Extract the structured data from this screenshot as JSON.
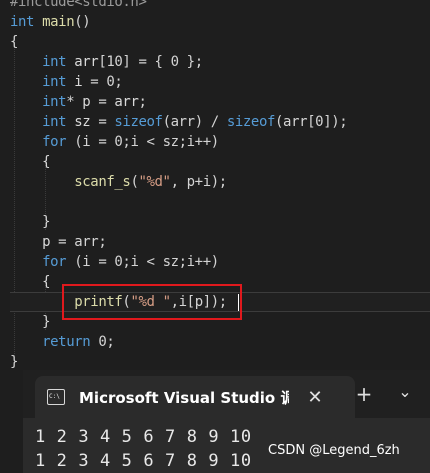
{
  "editor": {
    "lines": [
      [
        {
          "t": "#include<stdio.h>",
          "c": "pp"
        }
      ],
      [
        {
          "t": "int",
          "c": "kw"
        },
        {
          "t": " ",
          "c": ""
        },
        {
          "t": "main",
          "c": "fn"
        },
        {
          "t": "()",
          "c": ""
        }
      ],
      [
        {
          "t": "{",
          "c": ""
        }
      ],
      [
        {
          "t": "    ",
          "c": ""
        },
        {
          "t": "int",
          "c": "kw"
        },
        {
          "t": " ",
          "c": ""
        },
        {
          "t": "arr",
          "c": "id"
        },
        {
          "t": "[10] = { 0 };",
          "c": ""
        }
      ],
      [
        {
          "t": "    ",
          "c": ""
        },
        {
          "t": "int",
          "c": "kw"
        },
        {
          "t": " ",
          "c": ""
        },
        {
          "t": "i",
          "c": "id"
        },
        {
          "t": " = 0;",
          "c": ""
        }
      ],
      [
        {
          "t": "    ",
          "c": ""
        },
        {
          "t": "int",
          "c": "kw"
        },
        {
          "t": "* ",
          "c": ""
        },
        {
          "t": "p",
          "c": "id"
        },
        {
          "t": " = ",
          "c": ""
        },
        {
          "t": "arr",
          "c": "id"
        },
        {
          "t": ";",
          "c": ""
        }
      ],
      [
        {
          "t": "    ",
          "c": ""
        },
        {
          "t": "int",
          "c": "kw"
        },
        {
          "t": " ",
          "c": ""
        },
        {
          "t": "sz",
          "c": "id"
        },
        {
          "t": " = ",
          "c": ""
        },
        {
          "t": "sizeof",
          "c": "kw"
        },
        {
          "t": "(arr) / ",
          "c": ""
        },
        {
          "t": "sizeof",
          "c": "kw"
        },
        {
          "t": "(arr[0]);",
          "c": ""
        }
      ],
      [
        {
          "t": "    ",
          "c": ""
        },
        {
          "t": "for",
          "c": "kw"
        },
        {
          "t": " (i = 0;i < sz;i++)",
          "c": ""
        }
      ],
      [
        {
          "t": "    {",
          "c": ""
        }
      ],
      [
        {
          "t": "        ",
          "c": ""
        },
        {
          "t": "scanf_s",
          "c": "fn"
        },
        {
          "t": "(",
          "c": ""
        },
        {
          "t": "\"%d\"",
          "c": "str"
        },
        {
          "t": ", p+i);",
          "c": ""
        }
      ],
      [
        {
          "t": "",
          "c": ""
        }
      ],
      [
        {
          "t": "    }",
          "c": ""
        }
      ],
      [
        {
          "t": "    ",
          "c": ""
        },
        {
          "t": "p",
          "c": "id"
        },
        {
          "t": " = arr;",
          "c": ""
        }
      ],
      [
        {
          "t": "    ",
          "c": ""
        },
        {
          "t": "for",
          "c": "kw"
        },
        {
          "t": " (i = 0;i < sz;i++)",
          "c": ""
        }
      ],
      [
        {
          "t": "    {",
          "c": ""
        }
      ],
      [
        {
          "t": "        ",
          "c": ""
        },
        {
          "t": "printf",
          "c": "fn"
        },
        {
          "t": "(",
          "c": ""
        },
        {
          "t": "\"%d \"",
          "c": "str"
        },
        {
          "t": ",i[p]);",
          "c": ""
        }
      ],
      [
        {
          "t": "    }",
          "c": ""
        }
      ],
      [
        {
          "t": "    ",
          "c": ""
        },
        {
          "t": "return",
          "c": "kw"
        },
        {
          "t": " 0;",
          "c": ""
        }
      ],
      [
        {
          "t": "}",
          "c": ""
        }
      ]
    ]
  },
  "console": {
    "tab_title": "Microsoft Visual Studio 调试控制台",
    "icon": "console-app-icon",
    "close_icon": "close-icon",
    "new_tab_icon": "plus-icon",
    "dropdown_icon": "chevron-down-icon",
    "output": [
      "1 2 3 4 5 6 7 8 9 10",
      "1 2 3 4 5 6 7 8 9 10"
    ]
  },
  "watermark": "CSDN @Legend_6zh",
  "colors": {
    "keyword": "#569cd6",
    "function": "#dcdcaa",
    "string": "#d69d85",
    "highlight_box": "#e0191d"
  }
}
